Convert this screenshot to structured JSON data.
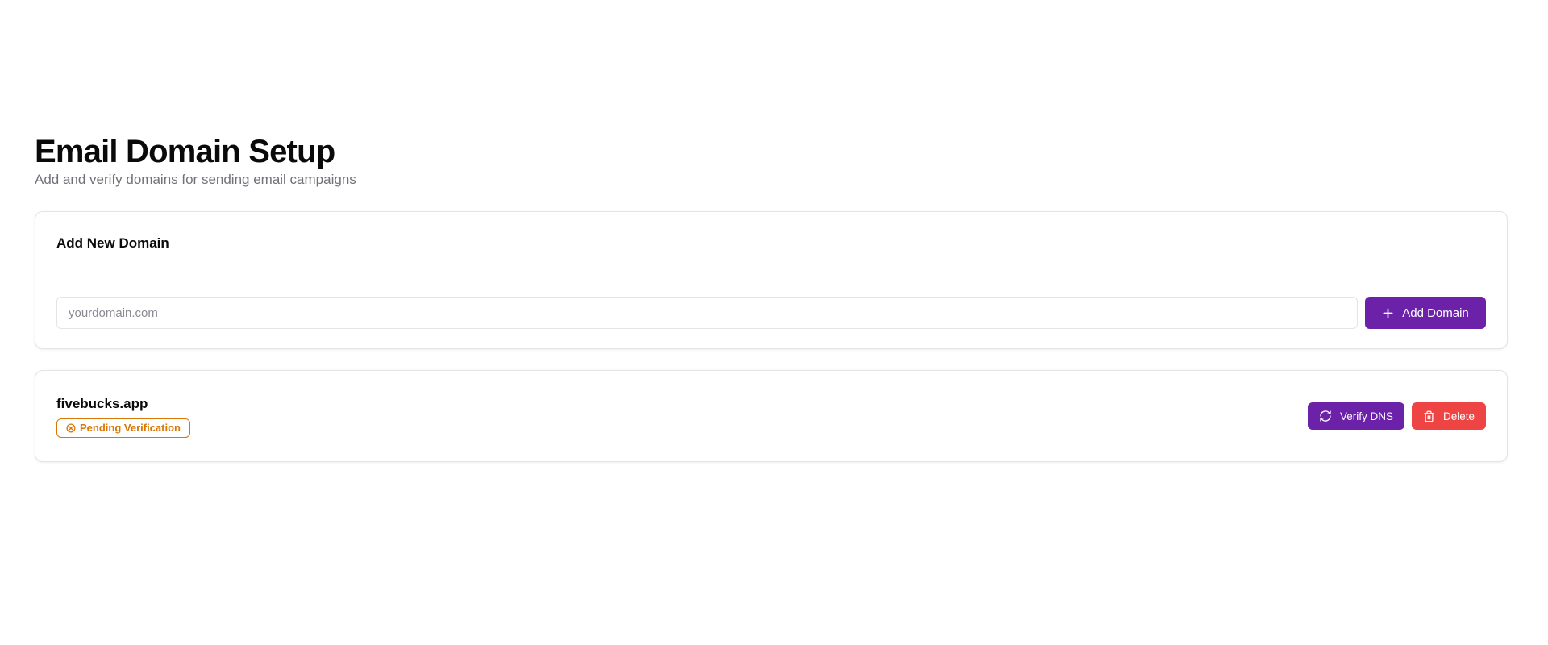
{
  "header": {
    "title": "Email Domain Setup",
    "subtitle": "Add and verify domains for sending email campaigns"
  },
  "add_domain": {
    "card_title": "Add New Domain",
    "input_value": "",
    "input_placeholder": "yourdomain.com",
    "button_label": "Add Domain",
    "button_icon": "plus-icon"
  },
  "domains": [
    {
      "name": "fivebucks.app",
      "status": "Pending Verification",
      "status_icon": "x-circle-icon",
      "verify_label": "Verify DNS",
      "verify_icon": "refresh-icon",
      "delete_label": "Delete",
      "delete_icon": "trash-icon"
    }
  ],
  "colors": {
    "primary": "#6b21a8",
    "danger": "#ef4444",
    "pending": "#d97706",
    "muted_text": "#71717a",
    "border": "#e4e4e7"
  }
}
